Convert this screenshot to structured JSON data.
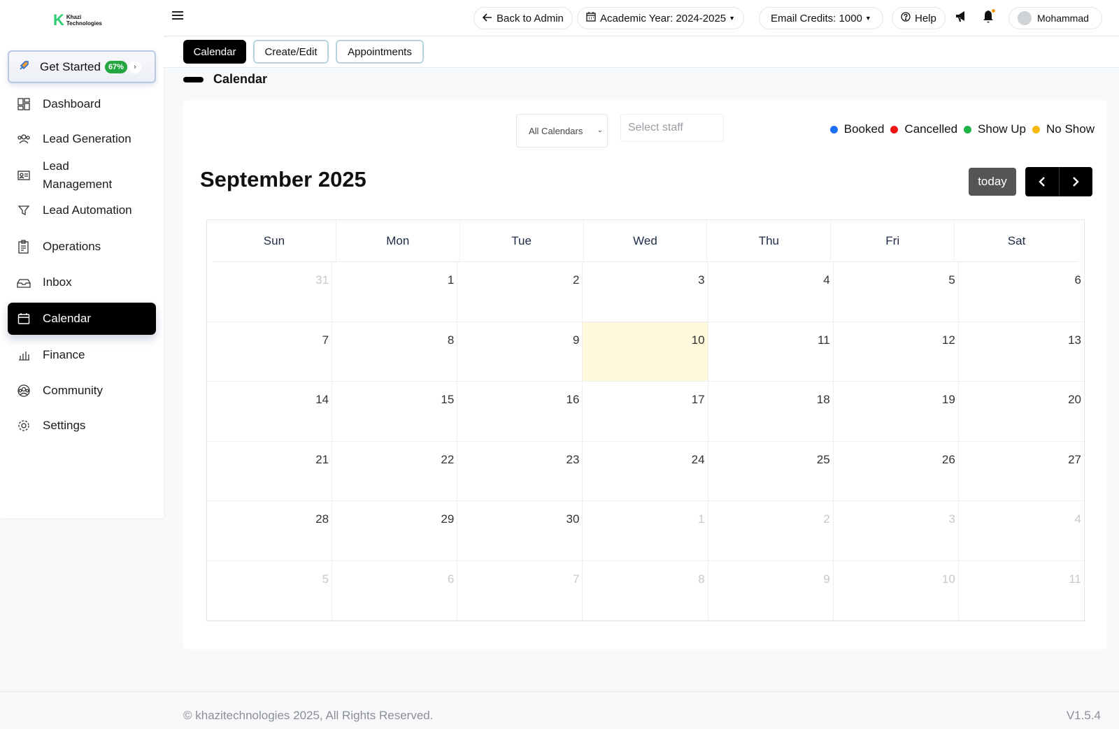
{
  "brand": {
    "logo_letter": "K",
    "logo_line1": "Khazi",
    "logo_line2": "Technologies"
  },
  "sidebar": {
    "get_started": {
      "label": "Get Started",
      "progress": "67%"
    },
    "items": [
      {
        "label": "Dashboard",
        "icon": "dashboard-icon"
      },
      {
        "label": "Lead Generation",
        "icon": "users-icon"
      },
      {
        "label": "Lead Management",
        "icon": "contact-card-icon"
      },
      {
        "label": "Lead Automation",
        "icon": "funnel-icon"
      },
      {
        "label": "Operations",
        "icon": "clipboard-icon"
      },
      {
        "label": "Inbox",
        "icon": "inbox-icon"
      },
      {
        "label": "Calendar",
        "icon": "calendar-icon"
      },
      {
        "label": "Finance",
        "icon": "bar-chart-icon"
      },
      {
        "label": "Community",
        "icon": "community-icon"
      },
      {
        "label": "Settings",
        "icon": "gear-icon"
      }
    ],
    "active": "Calendar"
  },
  "topbar": {
    "back_label": "Back to Admin",
    "academic_year": "Academic Year: 2024-2025",
    "email_credits": "Email Credits: 1000",
    "help_label": "Help",
    "user_name": "Mohammad"
  },
  "tabs": [
    {
      "label": "Calendar",
      "active": true
    },
    {
      "label": "Create/Edit",
      "active": false
    },
    {
      "label": "Appointments",
      "active": false
    }
  ],
  "section_title": "Calendar",
  "filters": {
    "calendar_select": "All Calendars",
    "staff_placeholder": "Select staff"
  },
  "legend": [
    {
      "label": "Booked",
      "color": "#1e6ef5"
    },
    {
      "label": "Cancelled",
      "color": "#f01313"
    },
    {
      "label": "Show Up",
      "color": "#1fb34a"
    },
    {
      "label": "No Show",
      "color": "#f5b80b"
    }
  ],
  "calendar": {
    "month_title": "September 2025",
    "today_label": "today",
    "weekdays": [
      "Sun",
      "Mon",
      "Tue",
      "Wed",
      "Thu",
      "Fri",
      "Sat"
    ],
    "days": [
      {
        "d": "31",
        "dim": true
      },
      {
        "d": "1"
      },
      {
        "d": "2"
      },
      {
        "d": "3"
      },
      {
        "d": "4"
      },
      {
        "d": "5"
      },
      {
        "d": "6"
      },
      {
        "d": "7"
      },
      {
        "d": "8"
      },
      {
        "d": "9"
      },
      {
        "d": "10",
        "today": true
      },
      {
        "d": "11"
      },
      {
        "d": "12"
      },
      {
        "d": "13"
      },
      {
        "d": "14"
      },
      {
        "d": "15"
      },
      {
        "d": "16"
      },
      {
        "d": "17"
      },
      {
        "d": "18"
      },
      {
        "d": "19"
      },
      {
        "d": "20"
      },
      {
        "d": "21"
      },
      {
        "d": "22"
      },
      {
        "d": "23"
      },
      {
        "d": "24"
      },
      {
        "d": "25"
      },
      {
        "d": "26"
      },
      {
        "d": "27"
      },
      {
        "d": "28"
      },
      {
        "d": "29"
      },
      {
        "d": "30"
      },
      {
        "d": "1",
        "dim": true
      },
      {
        "d": "2",
        "dim": true
      },
      {
        "d": "3",
        "dim": true
      },
      {
        "d": "4",
        "dim": true
      },
      {
        "d": "5",
        "dim": true
      },
      {
        "d": "6",
        "dim": true
      },
      {
        "d": "7",
        "dim": true
      },
      {
        "d": "8",
        "dim": true
      },
      {
        "d": "9",
        "dim": true
      },
      {
        "d": "10",
        "dim": true
      },
      {
        "d": "11",
        "dim": true
      }
    ]
  },
  "footer": {
    "copyright": "© khazitechnologies 2025, All Rights Reserved.",
    "version": "V1.5.4"
  }
}
